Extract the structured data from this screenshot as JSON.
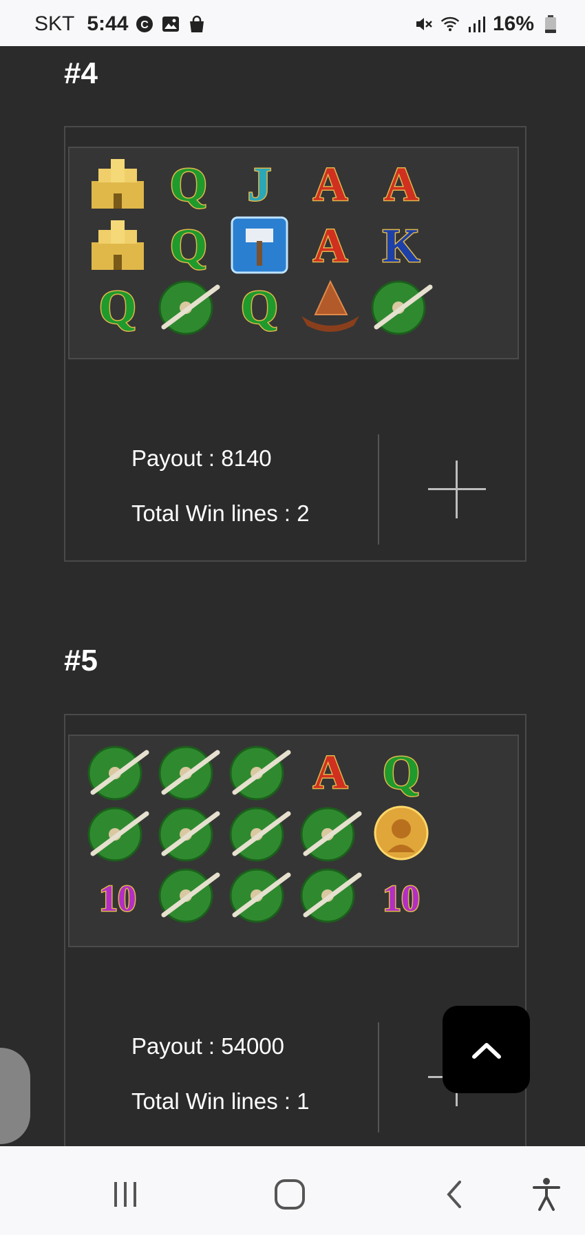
{
  "status_bar": {
    "carrier": "SKT",
    "time": "5:44",
    "battery": "16%",
    "left_icons": [
      "c-circle-icon",
      "image-icon",
      "shopping-bag-icon"
    ],
    "right_icons": [
      "mute-icon",
      "wifi-icon",
      "signal-icon",
      "battery-icon"
    ]
  },
  "results": [
    {
      "title": "#4",
      "reels": [
        [
          "castle",
          "Q",
          "J",
          "A",
          "A"
        ],
        [
          "castle",
          "Q",
          "hammer-wild",
          "A",
          "K"
        ],
        [
          "Q",
          "shield-sword",
          "Q",
          "viking-ship",
          "shield-sword"
        ]
      ],
      "payout_label": "Payout : 8140",
      "win_lines_label": "Total Win lines : 2"
    },
    {
      "title": "#5",
      "reels": [
        [
          "shield-sword",
          "shield-sword",
          "shield-sword",
          "A",
          "Q"
        ],
        [
          "shield-sword",
          "shield-sword",
          "shield-sword",
          "shield-sword",
          "warrior-coin"
        ],
        [
          "10",
          "shield-sword",
          "shield-sword",
          "shield-sword",
          "10"
        ]
      ],
      "payout_label": "Payout : 54000",
      "win_lines_label": "Total Win lines : 1"
    }
  ],
  "symbol_colors": {
    "Q": "#1f9a2c",
    "J": "#2ba7b8",
    "A": "#d0301f",
    "K": "#1d3fa8",
    "10": "#b32ec4",
    "gold": "#e0b84a"
  },
  "nav": {
    "items": [
      "recent-apps-icon",
      "home-icon",
      "back-icon",
      "accessibility-icon"
    ]
  }
}
